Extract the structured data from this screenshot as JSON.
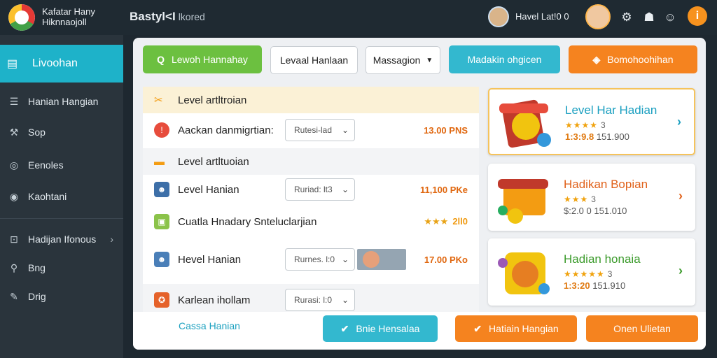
{
  "brand": {
    "line1": "Kafatar Hany",
    "line2": "Hiknnaojoll"
  },
  "app": {
    "title": "Bastyl<I",
    "subtitle": "lkored"
  },
  "header": {
    "user_name": "Havel Lat!0 0",
    "info_label": "i"
  },
  "sidebar": {
    "active": "Livoohan",
    "items": [
      {
        "label": "Hanian Hangian",
        "icon": "list-icon"
      },
      {
        "label": "Sop",
        "icon": "tool-icon"
      },
      {
        "label": "Eenoles",
        "icon": "circle-icon"
      },
      {
        "label": "Kaohtani",
        "icon": "target-icon"
      },
      {
        "label": "Hadijan Ifonous",
        "icon": "chart-icon"
      },
      {
        "label": "Bng",
        "icon": "search-icon"
      },
      {
        "label": "Drig",
        "icon": "puzzle-icon"
      }
    ]
  },
  "toolbar": {
    "search_label": "Lewoh Hannahay",
    "level_label": "Levaal Hanlaan",
    "message_label": "Massagion",
    "teal_label": "Madakin ohgicen",
    "orange_label": "Bomohoohihan"
  },
  "list": {
    "section1": "Level artltroian",
    "row1": {
      "label": "Aackan danmigrtian:",
      "select": "Rutesi-lad",
      "points": "13.00 PNS"
    },
    "section2": "Level artltuoian",
    "row2": {
      "label": "Level Hanian",
      "select": "Ruriad: lt3",
      "points": "11,100 PKe"
    },
    "row3": {
      "label": "Cuatla Hnadary Snteluclarjian",
      "stars": "★★★",
      "score": "2ll0"
    },
    "row4": {
      "label": "Hevel Hanian",
      "select": "Rurnes. l:0",
      "points": "17.00 PKo"
    },
    "row5": {
      "label": "Karlean ihollam",
      "select": "Rurasi: l:0"
    }
  },
  "cards": [
    {
      "title": "Level Har Hadian",
      "stars": "★★★★",
      "star_count": "3",
      "value_a": "1:3:9.8",
      "value_b": "151.900",
      "title_color": "#1a9fc0"
    },
    {
      "title": "Hadikan Bopian",
      "stars": "★★★",
      "star_count": "3",
      "value_a": "$:2.0 0",
      "value_b": "151.010",
      "title_color": "#e0611a"
    },
    {
      "title": "Hadian honaia",
      "stars": "★★★★★",
      "star_count": "3",
      "value_a": "1:3:20",
      "value_b": "151.910",
      "title_color": "#3a9a2a"
    }
  ],
  "footer": {
    "link": "Cassa Hanian",
    "btn_teal": "Bnie Hensalaa",
    "btn_orange": "Hatiain Hangian",
    "btn_orange2": "Onen Ulietan"
  }
}
